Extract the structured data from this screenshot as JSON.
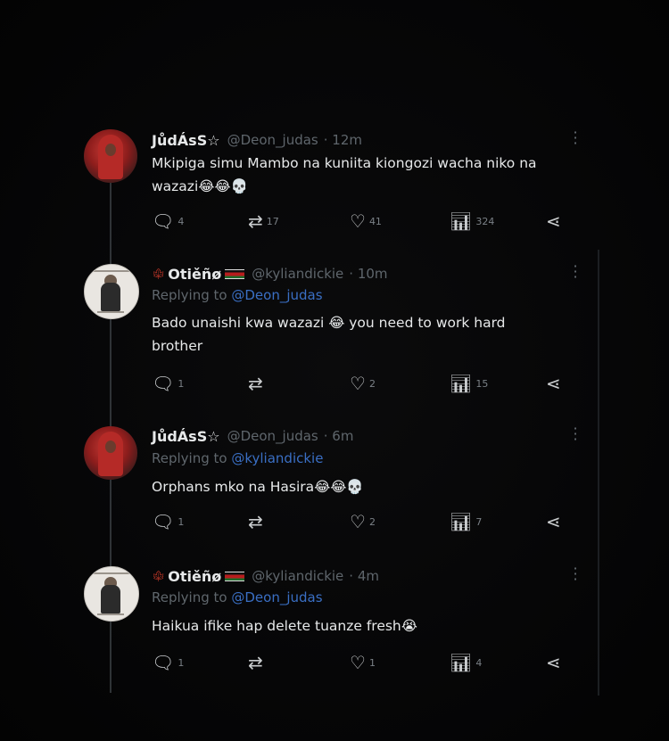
{
  "tweets": [
    {
      "name": "JůdÁsS☆",
      "handle": "@Deon_judas",
      "time": "· 12m",
      "replying_to": "",
      "text": "Mkipiga simu Mambo na kuniita kiongozi wacha niko na wazazi😂😂💀",
      "counts": {
        "reply": "4",
        "retweet": "17",
        "like": "41",
        "views": "324"
      }
    },
    {
      "name": "Otiěñø",
      "handle": "@kyliandickie",
      "time": "· 10m",
      "replying_to_label": "Replying to",
      "replying_to": "@Deon_judas",
      "text": "Bado unaishi kwa wazazi 😂 you need to work hard brother",
      "counts": {
        "reply": "1",
        "retweet": "",
        "like": "2",
        "views": "15"
      }
    },
    {
      "name": "JůdÁsS☆",
      "handle": "@Deon_judas",
      "time": "· 6m",
      "replying_to_label": "Replying to",
      "replying_to": "@kyliandickie",
      "text": "Orphans mko na Hasira😂😂💀",
      "counts": {
        "reply": "1",
        "retweet": "",
        "like": "2",
        "views": "7"
      }
    },
    {
      "name": "Otiěñø",
      "handle": "@kyliandickie",
      "time": "· 4m",
      "replying_to_label": "Replying to",
      "replying_to": "@Deon_judas",
      "text": "Haikua ifike hap delete tuanze fresh😭",
      "counts": {
        "reply": "1",
        "retweet": "",
        "like": "1",
        "views": "4"
      }
    }
  ],
  "icons": {
    "reply": "speech-bubble-icon",
    "retweet": "retweet-icon",
    "like": "heart-icon",
    "views": "bar-chart-icon",
    "share": "share-icon",
    "more": "more-vertical-icon"
  },
  "colors": {
    "background": "#000000",
    "text": "#e7e9ea",
    "muted": "#5f666c",
    "link": "#3a6fc4"
  }
}
